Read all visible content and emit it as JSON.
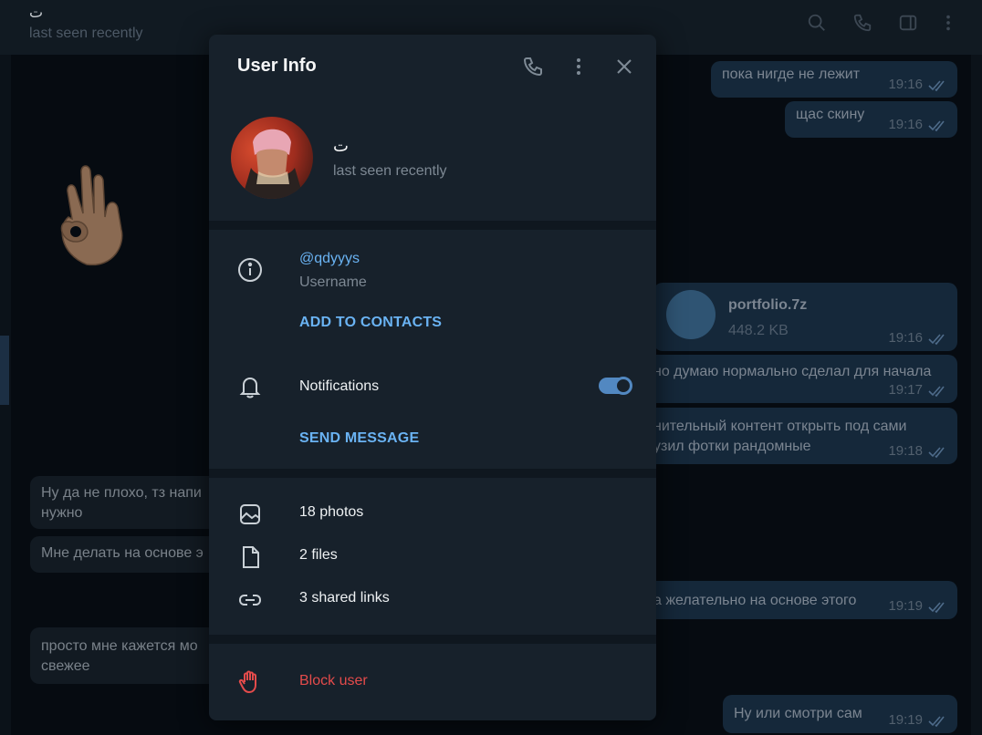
{
  "chat": {
    "title": "ت",
    "status": "last seen recently",
    "header_icons": [
      "search-icon",
      "phone-icon",
      "sidebar-icon",
      "more-icon"
    ]
  },
  "messages": [
    {
      "text": "пока нигде не лежит",
      "time": "19:16",
      "dir": "out"
    },
    {
      "text": "щас скину",
      "time": "19:16",
      "dir": "out"
    },
    {
      "text": "portfolio.7z",
      "size": "448.2 KB",
      "time": "19:16",
      "dir": "out",
      "type": "file"
    },
    {
      "text": "но думаю нормально сделал для начала",
      "time": "19:17",
      "dir": "out"
    },
    {
      "text": "нительный контент открыть под сами",
      "text2": "узил фотки рандомные",
      "time": "19:18",
      "dir": "out"
    },
    {
      "text": "Ну да не плохо, тз напи",
      "text2": "нужно",
      "dir": "in"
    },
    {
      "text": "Мне делать на основе э",
      "dir": "in"
    },
    {
      "text": "а желательно на основе этого",
      "time": "19:19",
      "dir": "out"
    },
    {
      "text": "просто мне кажется мо",
      "text2": "свежее",
      "dir": "in"
    },
    {
      "text": "Ну или смотри сам",
      "time": "19:19",
      "dir": "out"
    }
  ],
  "modal": {
    "title": "User Info",
    "user": {
      "name": "ت",
      "status": "last seen recently"
    },
    "info": {
      "username": "@qdyyys",
      "username_label": "Username",
      "add_to_contacts": "ADD TO CONTACTS",
      "notifications_label": "Notifications",
      "notifications_on": true,
      "send_message": "SEND MESSAGE"
    },
    "media": {
      "photos": "18 photos",
      "files": "2 files",
      "links": "3 shared links"
    },
    "block": "Block user"
  },
  "colors": {
    "accent": "#6ab3f3",
    "toggle": "#5288c1",
    "danger": "#e44b4b",
    "panel": "#17212b"
  }
}
